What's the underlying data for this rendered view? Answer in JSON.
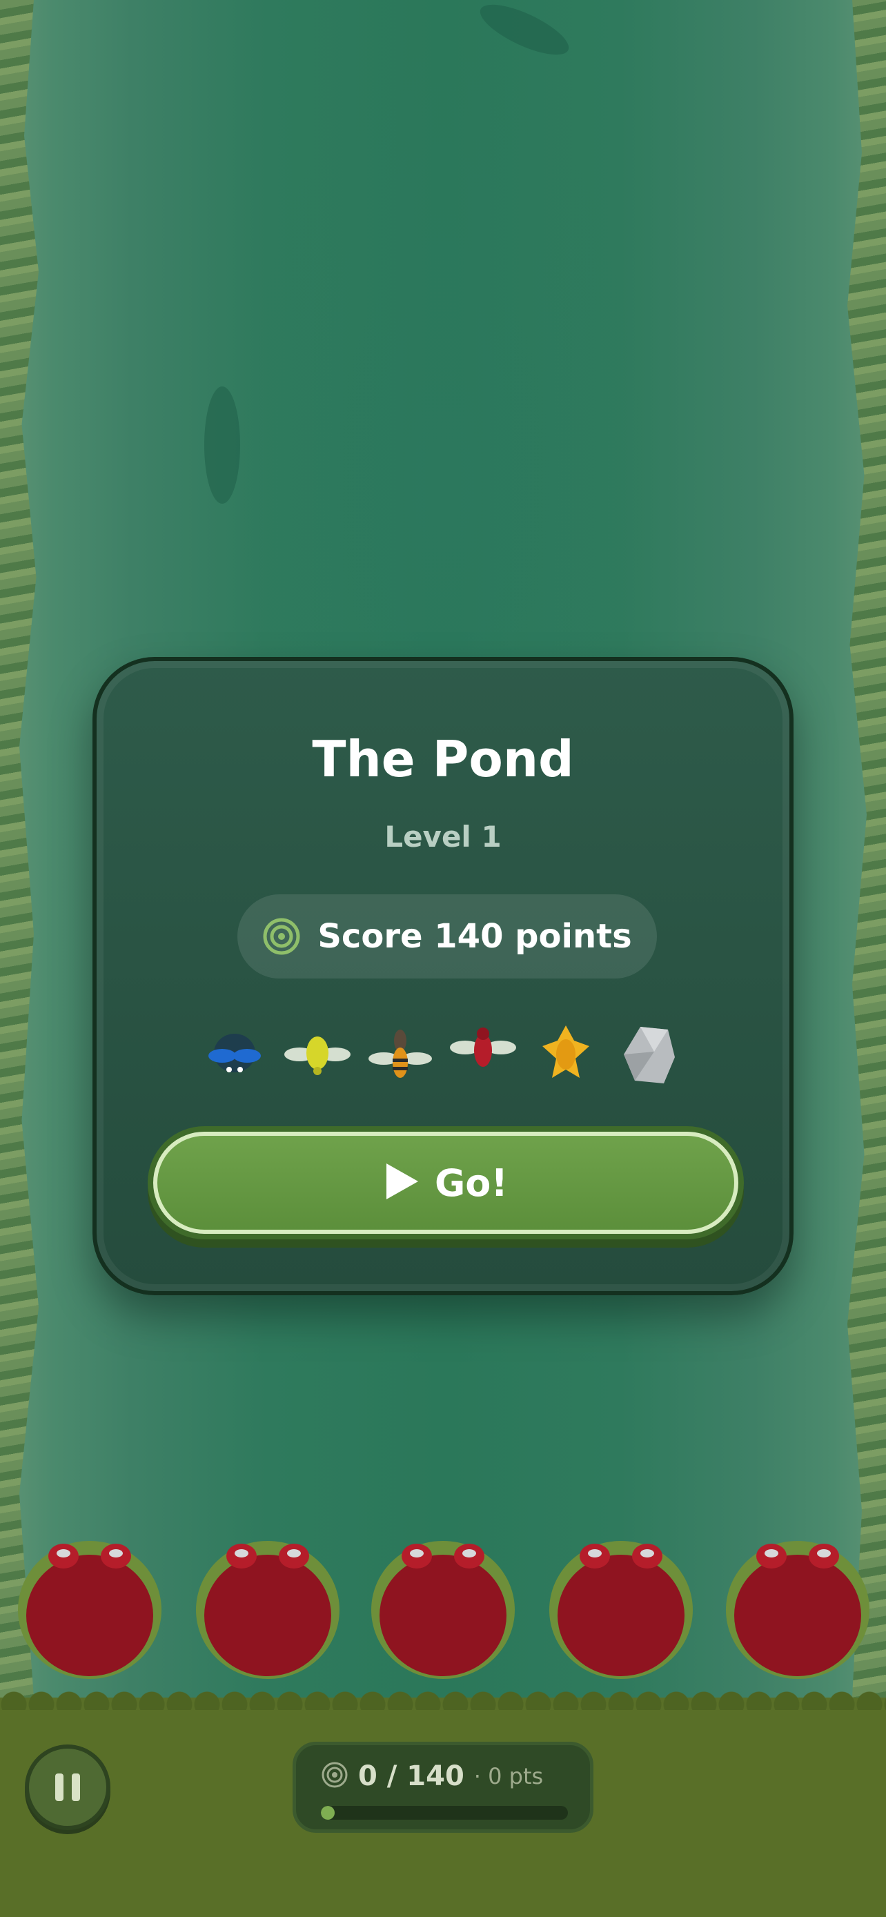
{
  "level_card": {
    "title": "The Pond",
    "level": "Level 1",
    "goal": "Score 140 points",
    "go_label": "Go!"
  },
  "creatures": [
    {
      "name": "blue-beetle-icon"
    },
    {
      "name": "yellow-fly-icon"
    },
    {
      "name": "wasp-icon"
    },
    {
      "name": "red-fly-icon"
    },
    {
      "name": "golden-beetle-icon"
    },
    {
      "name": "rock-icon"
    }
  ],
  "frogs_count": 5,
  "hud": {
    "progress_text": "0 / 140",
    "points_text": "· 0 pts",
    "progress_fraction": 0
  },
  "colors": {
    "water": "#2b785a",
    "card": "#2a5444",
    "go_button": "#6fa24b",
    "frog": "#8f1420",
    "grass": "#596f28"
  }
}
